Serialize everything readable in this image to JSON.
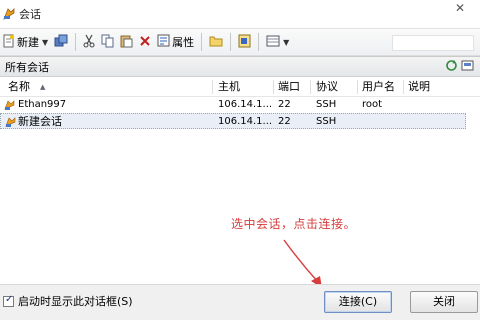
{
  "window": {
    "title": "会话",
    "close_glyph": "✕"
  },
  "toolbar": {
    "new_label": "新建",
    "properties_label": "属性",
    "search_placeholder": ""
  },
  "panel": {
    "title": "所有会话"
  },
  "columns": {
    "name": "名称",
    "sort_glyph": "▲",
    "host": "主机",
    "port": "端口",
    "protocol": "协议",
    "username": "用户名",
    "description": "说明"
  },
  "sessions": [
    {
      "name": "Ethan997",
      "host": "106.14.1...",
      "port": "22",
      "protocol": "SSH",
      "username": "root",
      "description": ""
    },
    {
      "name": "新建会话",
      "host": "106.14.1...",
      "port": "22",
      "protocol": "SSH",
      "username": "",
      "description": ""
    }
  ],
  "annotation": {
    "text": "选中会话，点击连接。",
    "color": "#d83c3c"
  },
  "footer": {
    "startup_checkbox_label": "启动时显示此对话框(S)",
    "startup_checked": true,
    "connect_label": "连接(C)",
    "close_label": "关闭"
  },
  "icons": {
    "app": "session-app-icon",
    "new": "new-session-icon",
    "cut": "scissors-icon",
    "copy": "copy-icon",
    "paste": "paste-icon",
    "delete": "delete-icon",
    "properties": "properties-icon",
    "folder": "folder-icon",
    "view": "view-icon"
  }
}
